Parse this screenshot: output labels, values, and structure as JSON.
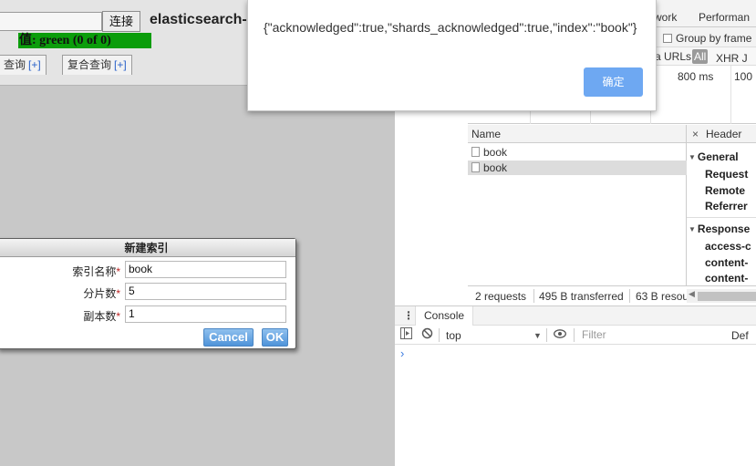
{
  "left": {
    "connect_button": "连接",
    "app_title": "elasticsearch-",
    "health": "值: green (0 of 0)",
    "tabs": [
      {
        "label": "查询",
        "plus": "[+]"
      },
      {
        "label": "复合查询",
        "plus": "[+]"
      }
    ],
    "dialog": {
      "title": "新建索引",
      "fields": [
        {
          "label": "索引名称",
          "required_mark": "*",
          "value": "book"
        },
        {
          "label": "分片数",
          "required_mark": "*",
          "value": "5"
        },
        {
          "label": "副本数",
          "required_mark": "*",
          "value": "1"
        }
      ],
      "cancel_label": "Cancel",
      "ok_label": "OK"
    }
  },
  "alert": {
    "message": "{\"acknowledged\":true,\"shards_acknowledged\":true,\"index\":\"book\"}",
    "confirm_label": "确定"
  },
  "devtools": {
    "tabs": [
      "work",
      "Performan"
    ],
    "group_by_frame": "Group by frame",
    "urls_label": "a URLs",
    "all_chip": "All",
    "xhr_label": "XHR  J",
    "timeline_ticks": [
      "800 ms",
      "100"
    ],
    "requests": {
      "header": "Name",
      "rows": [
        "book",
        "book"
      ],
      "selected_index": 1
    },
    "headers_panel": {
      "close": "×",
      "tab": "Header",
      "general": "General",
      "general_items": [
        "Request",
        "Remote",
        "Referrer"
      ],
      "response": "Response",
      "response_items": [
        "access-c",
        "content-",
        "content-"
      ]
    },
    "status": {
      "requests": "2 requests",
      "transferred": "495 B transferred",
      "resources": "63 B resou"
    },
    "console": {
      "tab": "Console",
      "context": "top",
      "filter_placeholder": "Filter",
      "levels": "Def",
      "prompt": "›"
    }
  }
}
